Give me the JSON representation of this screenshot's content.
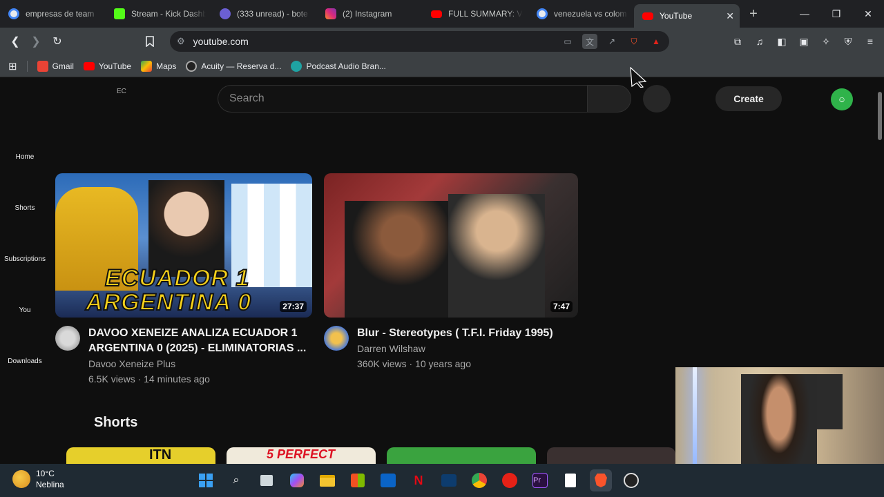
{
  "tabs": [
    {
      "title": "empresas de team",
      "color": "#e8eaed"
    },
    {
      "title": "Stream - Kick Dashb",
      "color": "#53fc18"
    },
    {
      "title": "(333 unread) - bote",
      "color": "#6b5fd3"
    },
    {
      "title": "(2) Instagram",
      "color": "#d62976"
    },
    {
      "title": "FULL SUMMARY: Ve",
      "color": "#ff0000"
    },
    {
      "title": "venezuela vs colom",
      "color": "#e8eaed"
    },
    {
      "title": "YouTube",
      "color": "#ff0000"
    }
  ],
  "toolbar": {
    "url": "youtube.com"
  },
  "bookmarks": [
    {
      "label": "Gmail",
      "color": "#ea4335"
    },
    {
      "label": "YouTube",
      "color": "#ff0000"
    },
    {
      "label": "Maps",
      "color": "#34a853"
    },
    {
      "label": "Acuity — Reserva d...",
      "color": "#222222"
    },
    {
      "label": "Podcast Audio Bran...",
      "color": "#1fa3a3"
    }
  ],
  "youtube": {
    "region": "EC",
    "search_placeholder": "Search",
    "create_label": "Create",
    "sidebar": [
      "Home",
      "Shorts",
      "Subscriptions",
      "You",
      "Downloads"
    ],
    "videos": [
      {
        "title": "DAVOO XENEIZE ANALIZA ECUADOR 1 ARGENTINA 0 (2025) - ELIMINATORIAS ...",
        "channel": "Davoo Xeneize Plus",
        "stats": "6.5K views · 14 minutes ago",
        "duration": "27:37",
        "thumb_line1": "ECUADOR 1",
        "thumb_line2": "ARGENTINA 0"
      },
      {
        "title": "Blur - Stereotypes ( T.F.I. Friday 1995)",
        "channel": "Darren Wilshaw",
        "stats": "360K views · 10 years ago",
        "duration": "7:47"
      }
    ],
    "shorts_heading": "Shorts",
    "shorts_peek": [
      "ITN",
      "5 PERFECT",
      "",
      ""
    ]
  },
  "taskbar": {
    "temp": "10°C",
    "condition": "Neblina"
  },
  "colors": {
    "accent": "#ff0000",
    "avatar": "#2fb34a",
    "bg": "#0f0f0f"
  }
}
